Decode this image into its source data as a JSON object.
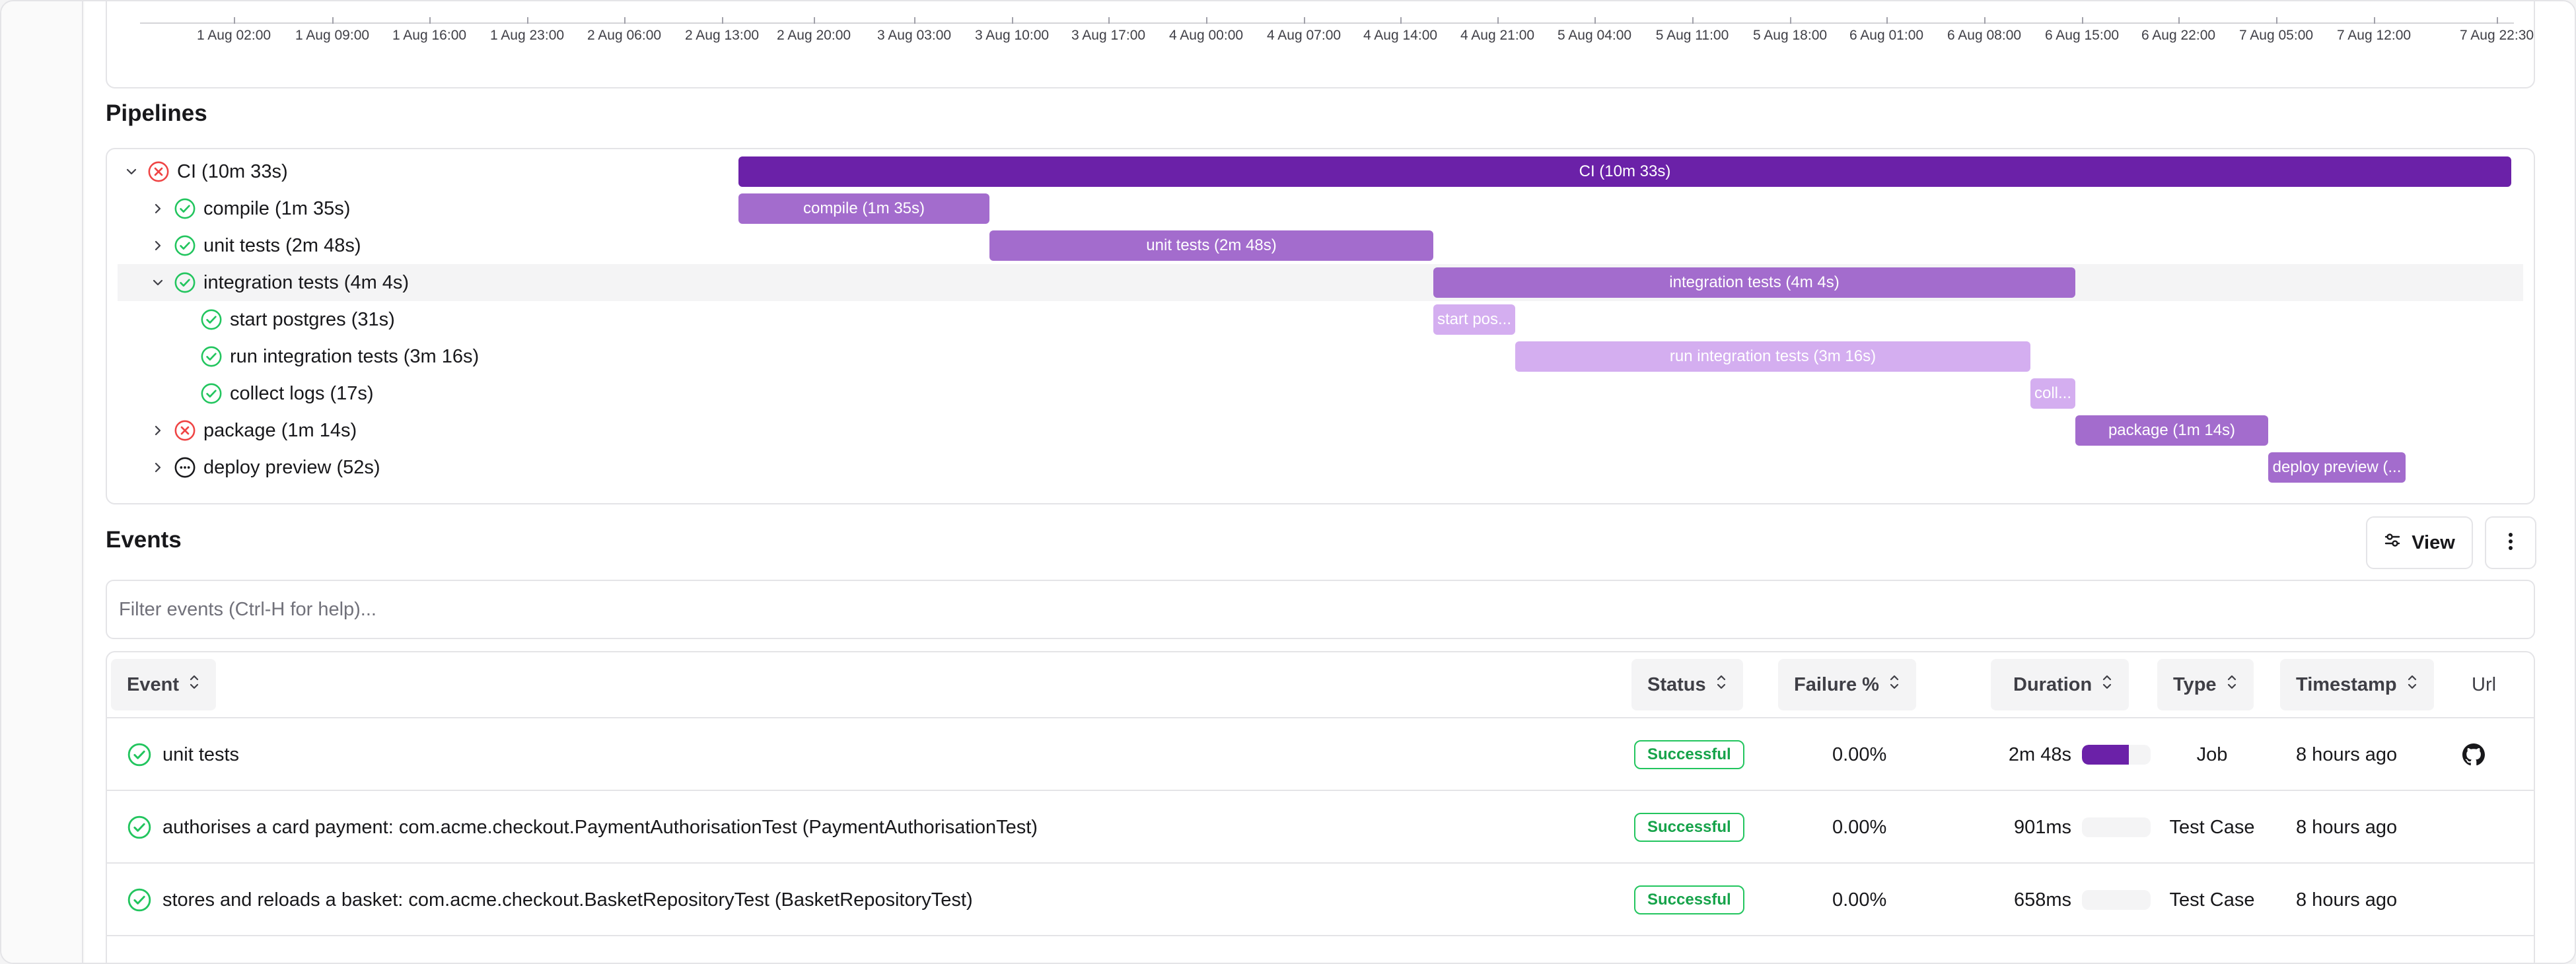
{
  "colors": {
    "bar_dark": "#6b21a8",
    "bar_mid": "#a36ccd",
    "bar_light": "#d4aef0",
    "success": "#22c55e",
    "failure": "#ef4444"
  },
  "timeline": {
    "ticks": [
      "1 Aug 02:00",
      "1 Aug 09:00",
      "1 Aug 16:00",
      "1 Aug 23:00",
      "2 Aug 06:00",
      "2 Aug 13:00",
      "2 Aug 20:00",
      "3 Aug 03:00",
      "3 Aug 10:00",
      "3 Aug 17:00",
      "4 Aug 00:00",
      "4 Aug 07:00",
      "4 Aug 14:00",
      "4 Aug 21:00",
      "5 Aug 04:00",
      "5 Aug 11:00",
      "5 Aug 18:00",
      "6 Aug 01:00",
      "6 Aug 08:00",
      "6 Aug 15:00",
      "6 Aug 22:00",
      "7 Aug 05:00",
      "7 Aug 12:00",
      "7 Aug 22:30"
    ]
  },
  "pipelines": {
    "title": "Pipelines",
    "rows": [
      {
        "label": "CI (10m 33s)",
        "bar_label": "CI (10m 33s)",
        "status": "failure",
        "expander": "expanded"
      },
      {
        "label": "compile (1m 35s)",
        "bar_label": "compile (1m 35s)",
        "status": "success",
        "expander": "collapsed"
      },
      {
        "label": "unit tests (2m 48s)",
        "bar_label": "unit tests (2m 48s)",
        "status": "success",
        "expander": "collapsed"
      },
      {
        "label": "integration tests (4m 4s)",
        "bar_label": "integration tests (4m 4s)",
        "status": "success",
        "expander": "expanded"
      },
      {
        "label": "start postgres (31s)",
        "bar_label": "start pos...",
        "status": "success",
        "expander": "none"
      },
      {
        "label": "run integration tests (3m 16s)",
        "bar_label": "run integration tests (3m 16s)",
        "status": "success",
        "expander": "none"
      },
      {
        "label": "collect logs (17s)",
        "bar_label": "coll...",
        "status": "success",
        "expander": "none"
      },
      {
        "label": "package (1m 14s)",
        "bar_label": "package (1m 14s)",
        "status": "failure",
        "expander": "collapsed"
      },
      {
        "label": "deploy preview (52s)",
        "bar_label": "deploy preview (...",
        "status": "pending",
        "expander": "collapsed"
      }
    ]
  },
  "events": {
    "title": "Events",
    "view_label": "View",
    "filter_placeholder": "Filter events (Ctrl-H for help)...",
    "columns": [
      "Event",
      "Status",
      "Failure %",
      "Duration",
      "Type",
      "Timestamp",
      "Url"
    ],
    "rows": [
      {
        "event": "unit tests",
        "status": "Successful",
        "failure": "0.00%",
        "duration": "2m 48s",
        "duration_fraction": 0.68,
        "type": "Job",
        "timestamp": "8 hours ago",
        "url_icon": "github-icon"
      },
      {
        "event": "authorises a card payment: com.acme.checkout.PaymentAuthorisationTest (PaymentAuthorisationTest)",
        "status": "Successful",
        "failure": "0.00%",
        "duration": "901ms",
        "duration_fraction": 0.0,
        "type": "Test Case",
        "timestamp": "8 hours ago",
        "url_icon": ""
      },
      {
        "event": "stores and reloads a basket: com.acme.checkout.BasketRepositoryTest (BasketRepositoryTest)",
        "status": "Successful",
        "failure": "0.00%",
        "duration": "658ms",
        "duration_fraction": 0.0,
        "type": "Test Case",
        "timestamp": "8 hours ago",
        "url_icon": ""
      }
    ]
  }
}
